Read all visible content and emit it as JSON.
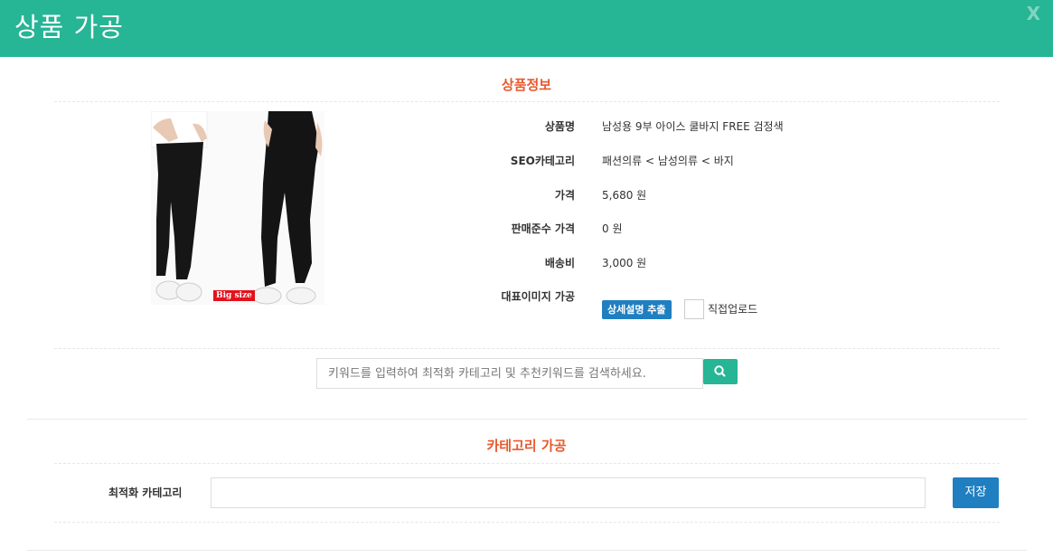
{
  "header": {
    "title": "상품 가공",
    "close_label": "X"
  },
  "product_info": {
    "section_title": "상품정보",
    "image_badge": "Big size",
    "rows": [
      {
        "label": "상품명",
        "value": "남성용 9부 아이스 쿨바지 FREE 검정색"
      },
      {
        "label": "SEO카테고리",
        "value": "패션의류 < 남성의류 < 바지"
      },
      {
        "label": "가격",
        "value": "5,680 원"
      },
      {
        "label": "판매준수 가격",
        "value": "0 원"
      },
      {
        "label": "배송비",
        "value": "3,000 원"
      },
      {
        "label": "대표이미지 가공",
        "value": ""
      }
    ],
    "extract_button": "상세설명 추출",
    "direct_upload_label": "직접업로드",
    "direct_upload_checked": false
  },
  "search": {
    "placeholder": "키워드를 입력하여 최적화 카테고리 및 추천키워드를 검색하세요.",
    "value": "",
    "icon": "search-icon"
  },
  "category": {
    "section_title": "카테고리 가공",
    "field_label": "최적화 카테고리",
    "field_value": "",
    "save_button": "저장"
  },
  "colors": {
    "header": "#26b595",
    "section_title": "#e8592d",
    "primary_button": "#1f7fc1",
    "search_button": "#26b595"
  }
}
